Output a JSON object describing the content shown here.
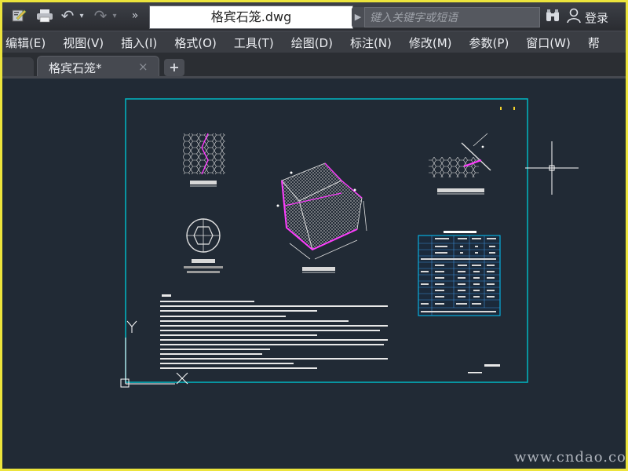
{
  "toolbar": {
    "icons": [
      "workspace-icon",
      "print-icon",
      "undo-icon",
      "redo-icon",
      "more-icon"
    ],
    "undo_glyph": "↶",
    "redo_glyph": "↷",
    "more_glyph": "»"
  },
  "document": {
    "title": "格宾石笼.dwg"
  },
  "search": {
    "placeholder": "键入关键字或短语"
  },
  "user": {
    "login_label": "登录"
  },
  "menu": {
    "items": [
      {
        "label": "编辑(E)"
      },
      {
        "label": "视图(V)"
      },
      {
        "label": "插入(I)"
      },
      {
        "label": "格式(O)"
      },
      {
        "label": "工具(T)"
      },
      {
        "label": "绘图(D)"
      },
      {
        "label": "标注(N)"
      },
      {
        "label": "修改(M)"
      },
      {
        "label": "参数(P)"
      },
      {
        "label": "窗口(W)"
      },
      {
        "label": "帮"
      }
    ]
  },
  "tabs": {
    "active_label": "格宾石笼*",
    "close_glyph": "×",
    "add_glyph": "+"
  },
  "drawing": {
    "ucs_y": "Y",
    "ucs_x": "X",
    "colors": {
      "sheet": "#00b7c3",
      "magenta": "#ff3cff",
      "white": "#ffffff",
      "canvas": "#212a35"
    }
  },
  "watermark": "www.cndao.com"
}
